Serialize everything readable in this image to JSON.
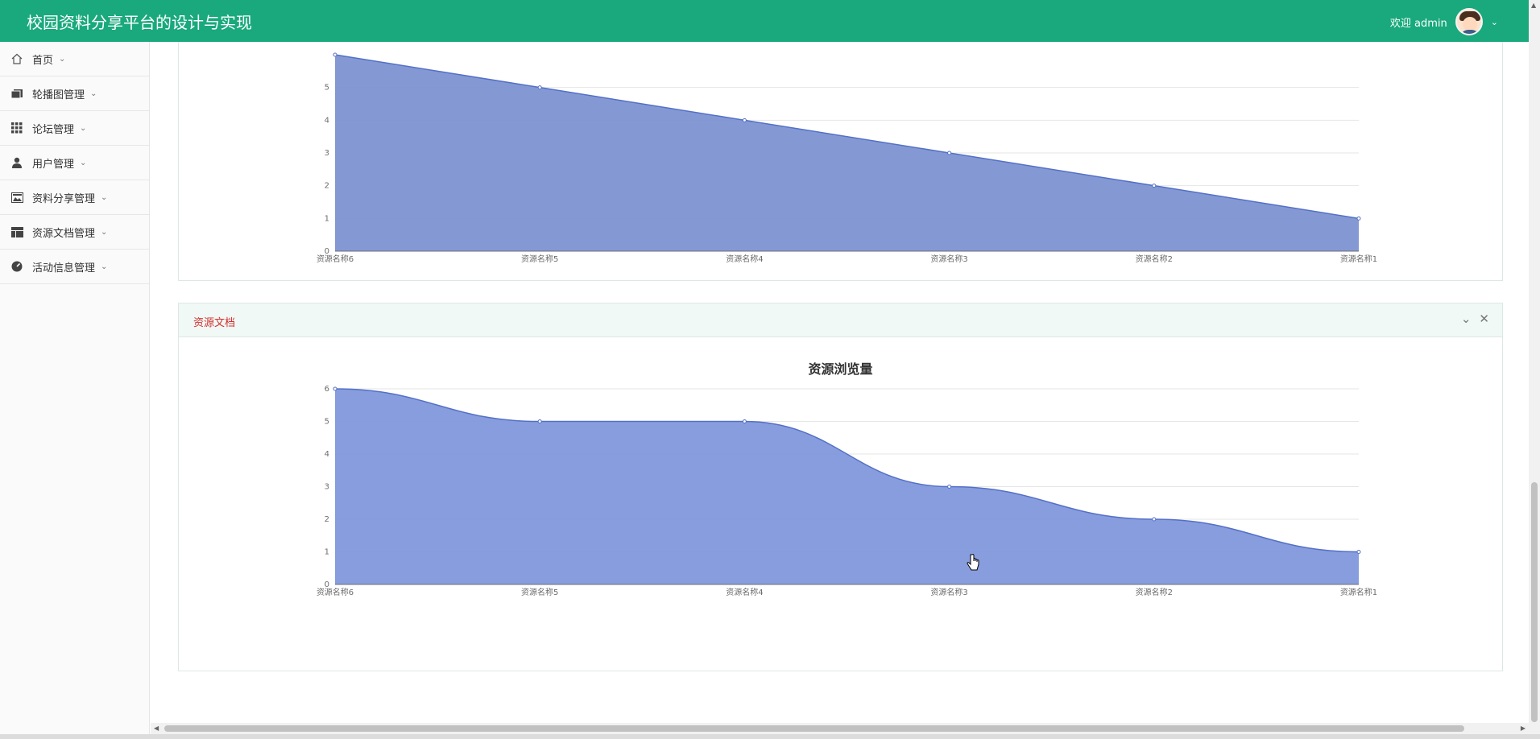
{
  "header": {
    "app_title": "校园资料分享平台的设计与实现",
    "welcome": "欢迎 admin",
    "avatar_icon": "avatar",
    "chevron_icon": "chevron-down-icon",
    "bg_color": "#19a97c"
  },
  "sidebar": {
    "items": [
      {
        "label": "首页",
        "icon": "home-icon"
      },
      {
        "label": "轮播图管理",
        "icon": "image-stack-icon"
      },
      {
        "label": "论坛管理",
        "icon": "grid-icon"
      },
      {
        "label": "用户管理",
        "icon": "user-icon"
      },
      {
        "label": "资料分享管理",
        "icon": "picture-icon"
      },
      {
        "label": "资源文档管理",
        "icon": "layout-icon"
      },
      {
        "label": "活动信息管理",
        "icon": "dashboard-icon"
      }
    ]
  },
  "panels": {
    "bottom": {
      "title": "资源文档",
      "collapse_icon": "chevron-down-icon",
      "close_icon": "close-icon"
    }
  },
  "chart_data": [
    {
      "type": "area",
      "title": "",
      "xlabel": "",
      "ylabel": "",
      "categories": [
        "资源名称6",
        "资源名称5",
        "资源名称4",
        "资源名称3",
        "资源名称2",
        "资源名称1"
      ],
      "values": [
        6,
        5,
        4,
        3,
        2,
        1
      ],
      "ylim": [
        0,
        6
      ],
      "yticks": [
        0,
        1,
        2,
        3,
        4,
        5
      ],
      "grid": true,
      "color": "#7d93d2"
    },
    {
      "type": "area",
      "title": "资源浏览量",
      "xlabel": "",
      "ylabel": "",
      "categories": [
        "资源名称6",
        "资源名称5",
        "资源名称4",
        "资源名称3",
        "资源名称2",
        "资源名称1"
      ],
      "values": [
        6,
        5,
        5,
        3,
        2,
        1
      ],
      "ylim": [
        0,
        6
      ],
      "yticks": [
        0,
        1,
        2,
        3,
        4,
        5,
        6
      ],
      "grid": true,
      "color": "#8198dc"
    }
  ]
}
